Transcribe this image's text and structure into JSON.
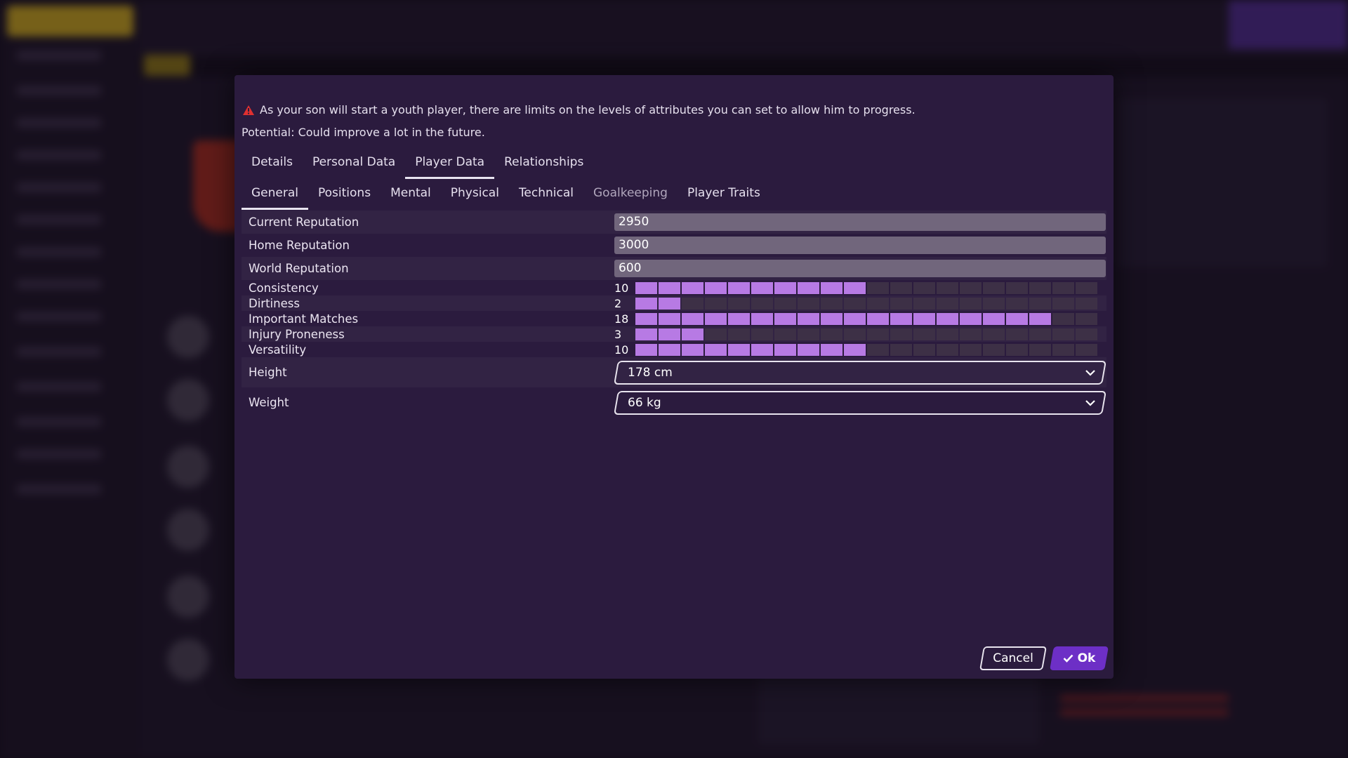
{
  "colors": {
    "modal_bg": "#2b1b3e",
    "accent": "#6d2fc6",
    "bar_on": "#b77ae4",
    "bar_off": "#3d3046",
    "warning": "#e03030"
  },
  "dialog": {
    "notice": "As your son will start a youth player, there are limits on the levels of attributes you can set to allow him to progress.",
    "potential": "Potential: Could improve a lot in the future."
  },
  "tabs_primary": [
    {
      "label": "Details"
    },
    {
      "label": "Personal Data"
    },
    {
      "label": "Player Data",
      "active": true
    },
    {
      "label": "Relationships"
    }
  ],
  "tabs_secondary": [
    {
      "label": "General",
      "active": true
    },
    {
      "label": "Positions"
    },
    {
      "label": "Mental"
    },
    {
      "label": "Physical"
    },
    {
      "label": "Technical"
    },
    {
      "label": "Goalkeeping",
      "dimmed": true
    },
    {
      "label": "Player Traits"
    }
  ],
  "reputation": [
    {
      "label": "Current Reputation",
      "value": "2950"
    },
    {
      "label": "Home Reputation",
      "value": "3000"
    },
    {
      "label": "World Reputation",
      "value": "600"
    }
  ],
  "attributes": {
    "max": 20,
    "items": [
      {
        "label": "Consistency",
        "value": 10
      },
      {
        "label": "Dirtiness",
        "value": 2
      },
      {
        "label": "Important Matches",
        "value": 18
      },
      {
        "label": "Injury Proneness",
        "value": 3
      },
      {
        "label": "Versatility",
        "value": 10
      }
    ]
  },
  "physique": [
    {
      "label": "Height",
      "value": "178 cm"
    },
    {
      "label": "Weight",
      "value": "66 kg"
    }
  ],
  "buttons": {
    "cancel": "Cancel",
    "ok": "Ok"
  },
  "icons": {
    "warning": "warning-triangle-icon",
    "chevron": "chevron-down-icon",
    "check": "check-icon"
  }
}
